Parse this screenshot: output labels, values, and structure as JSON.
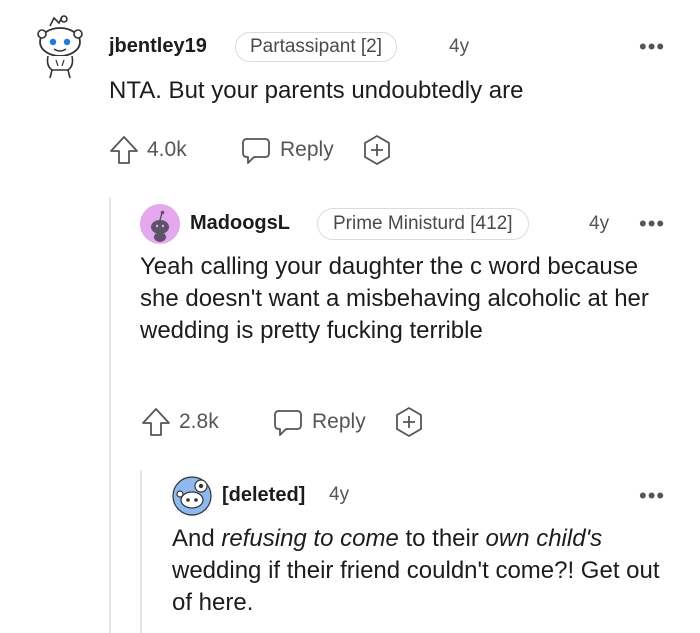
{
  "comments": [
    {
      "username": "jbentley19",
      "flair": "Partassipant [2]",
      "age": "4y",
      "more": "•••",
      "body": "NTA. But your parents undoubtedly are",
      "votes": "4.0k",
      "reply_label": "Reply"
    },
    {
      "username": "MadoogsL",
      "flair": "Prime Ministurd [412]",
      "age": "4y",
      "more": "•••",
      "body": "Yeah calling your daughter the c word because she doesn't want a misbehaving alcoholic at her wedding is pretty fucking terrible",
      "votes": "2.8k",
      "reply_label": "Reply"
    },
    {
      "username": "[deleted]",
      "age": "4y",
      "more": "•••",
      "body_parts": [
        "And ",
        "refusing to come",
        " to their ",
        "own child's",
        " wedding if their friend couldn't come?! Get out of here."
      ]
    }
  ]
}
